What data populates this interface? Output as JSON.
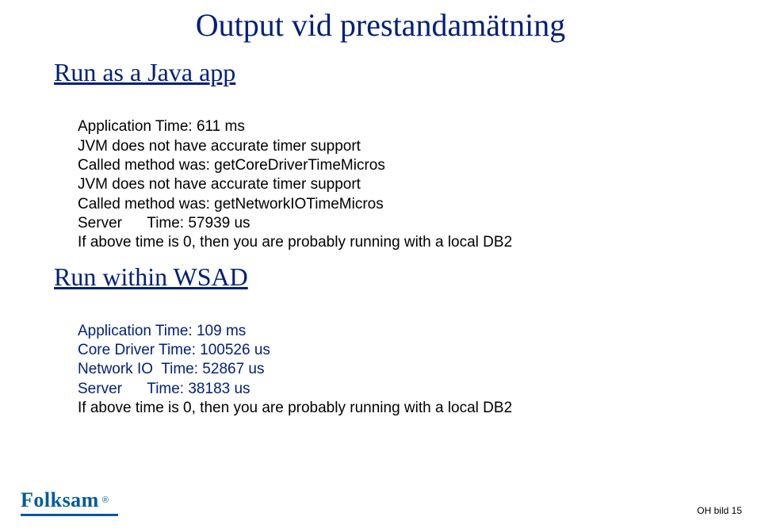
{
  "title": "Output vid prestandamätning",
  "section1": {
    "heading": "Run as a Java app",
    "lines": [
      "Application Time: 611 ms",
      "JVM does not have accurate timer support",
      "Called method was: getCoreDriverTimeMicros",
      "JVM does not have accurate timer support",
      "Called method was: getNetworkIOTimeMicros",
      "Server      Time: 57939 us",
      "If above time is 0, then you are probably running with a local DB2"
    ]
  },
  "section2": {
    "heading": "Run within WSAD",
    "lines": [
      "Application Time: 109 ms",
      "Core Driver Time: 100526 us",
      "Network IO  Time: 52867 us",
      "Server      Time: 38183 us",
      "If above time is 0, then you are probably running with a local DB2"
    ]
  },
  "brand": "Folksam",
  "brand_reg": "®",
  "page_number": "OH bild 15"
}
